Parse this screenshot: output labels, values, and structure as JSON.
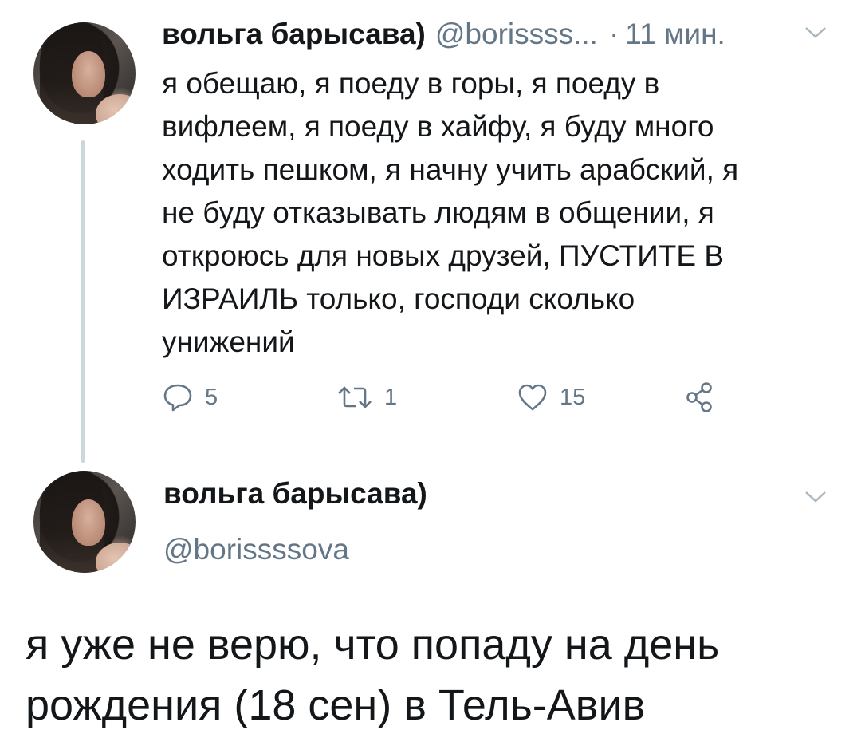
{
  "tweet": {
    "author_name": "вольга барысава)",
    "author_handle": "@borissss...",
    "separator": "·",
    "time": "11 мин.",
    "text_lines": [
      "я обещаю, я поеду в горы, я поеду в",
      "вифлеем, я поеду в хайфу, я буду много",
      "ходить пешком, я начну учить арабский, я",
      "не буду отказывать людям в общении, я",
      "откроюсь для новых друзей, ПУСТИТЕ В",
      "ИЗРАИЛЬ только, господи сколько",
      "унижений"
    ],
    "actions": {
      "reply_count": "5",
      "retweet_count": "1",
      "like_count": "15"
    }
  },
  "reply": {
    "author_name": "вольга барысава)",
    "author_handle": "@borissssova",
    "text_lines": [
      "я уже не верю, что попаду на день",
      "рождения (18 сен) в Тель-Авив"
    ]
  },
  "icons": {
    "reply": "reply-icon",
    "retweet": "retweet-icon",
    "like": "heart-icon",
    "share": "share-icon",
    "caret": "chevron-down-icon"
  },
  "colors": {
    "text": "#14171a",
    "secondary": "#657786",
    "thread_line": "#ccd6dd"
  }
}
